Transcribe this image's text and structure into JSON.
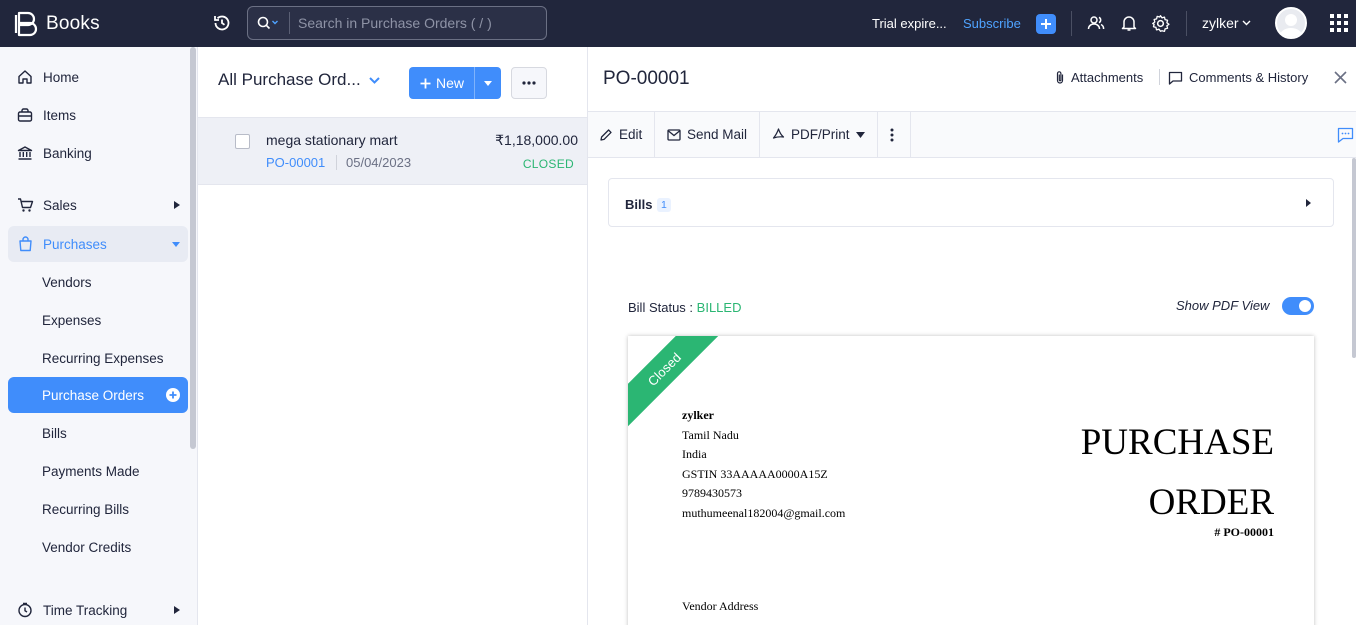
{
  "app": {
    "name": "Books"
  },
  "search": {
    "placeholder": "Search in Purchase Orders ( / )"
  },
  "topbar": {
    "trial_text": "Trial expire...",
    "subscribe_label": "Subscribe",
    "org_name": "zylker",
    "icons": [
      "history-icon",
      "search-icon",
      "plus-icon",
      "users-icon",
      "bell-icon",
      "gear-icon",
      "apps-grid-icon"
    ]
  },
  "sidebar": {
    "items": [
      {
        "label": "Home",
        "icon": "home-icon"
      },
      {
        "label": "Items",
        "icon": "items-icon"
      },
      {
        "label": "Banking",
        "icon": "bank-icon"
      },
      {
        "label": "Sales",
        "icon": "cart-icon"
      },
      {
        "label": "Purchases",
        "icon": "bag-icon"
      },
      {
        "label": "Vendors"
      },
      {
        "label": "Expenses"
      },
      {
        "label": "Recurring Expenses"
      },
      {
        "label": "Purchase Orders"
      },
      {
        "label": "Bills"
      },
      {
        "label": "Payments Made"
      },
      {
        "label": "Recurring Bills"
      },
      {
        "label": "Vendor Credits"
      },
      {
        "label": "Time Tracking",
        "icon": "clock-icon"
      }
    ]
  },
  "list": {
    "title": "All Purchase Ord...",
    "new_label": "New",
    "rows": [
      {
        "vendor": "mega stationary mart",
        "amount": "₹1,18,000.00",
        "po_number": "PO-00001",
        "date": "05/04/2023",
        "status": "CLOSED"
      }
    ]
  },
  "detail": {
    "title": "PO-00001",
    "attachments_label": "Attachments",
    "comments_label": "Comments & History",
    "toolbar": {
      "edit": "Edit",
      "send_mail": "Send Mail",
      "pdf_print": "PDF/Print"
    },
    "bills": {
      "label": "Bills",
      "count": "1"
    },
    "bill_status_label": "Bill Status :",
    "bill_status_value": "BILLED",
    "pdf_view_label": "Show PDF View",
    "pdf_view_on": true,
    "pdf": {
      "ribbon": "Closed",
      "org_name": "zylker",
      "address_lines": [
        "Tamil Nadu",
        "India",
        "GSTIN 33AAAAA0000A15Z",
        "9789430573",
        "muthumeenal182004@gmail.com"
      ],
      "title_line1": "PURCHASE",
      "title_line2": "ORDER",
      "number": "# PO-00001",
      "vendor_address_label": "Vendor Address"
    }
  },
  "colors": {
    "topbar": "#21263c",
    "accent": "#408dfb",
    "success": "#2bb673",
    "sidebar_bg": "#f6f7fb"
  }
}
